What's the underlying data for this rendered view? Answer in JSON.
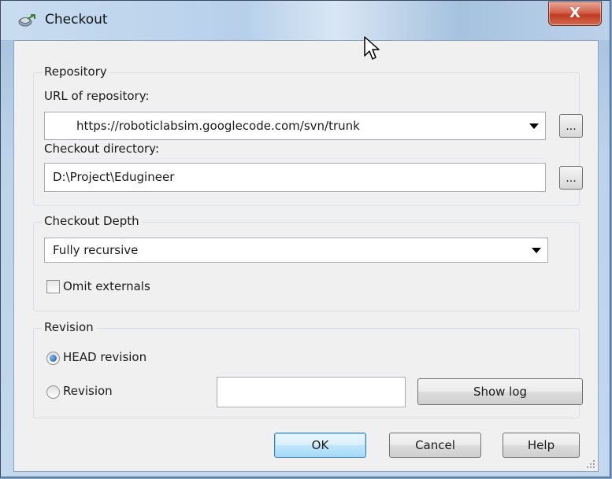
{
  "window": {
    "title": "Checkout",
    "close_glyph": "X",
    "accent": "#c03a22"
  },
  "repository": {
    "legend": "Repository",
    "url_label": "URL of repository:",
    "url_value": "https://roboticlabsim.googlecode.com/svn/trunk",
    "browse_label": "...",
    "dir_label": "Checkout directory:",
    "dir_value": "D:\\Project\\Edugineer"
  },
  "depth": {
    "legend": "Checkout Depth",
    "selected": "Fully recursive",
    "omit_externals_label": "Omit externals",
    "omit_externals_checked": false
  },
  "revision": {
    "legend": "Revision",
    "head_label": "HEAD revision",
    "head_selected": true,
    "revision_label": "Revision",
    "revision_value": "",
    "show_log_label": "Show log"
  },
  "buttons": {
    "ok": "OK",
    "cancel": "Cancel",
    "help": "Help"
  },
  "icons": {
    "title": "checkout-icon",
    "cursor": "mouse-pointer-icon"
  }
}
